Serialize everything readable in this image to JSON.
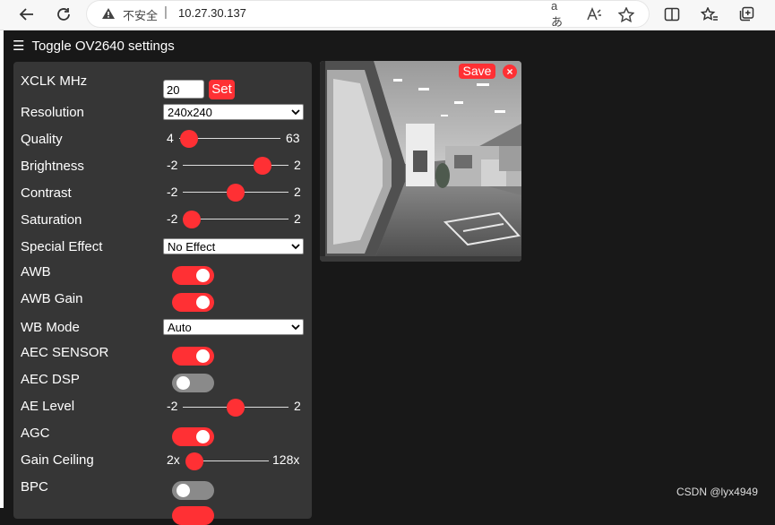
{
  "browser": {
    "security_text": "不安全",
    "separator": "|",
    "url": "10.27.30.137",
    "read_aloud_icon": "aあ"
  },
  "header": {
    "hamburger": "☰",
    "title": "Toggle OV2640 settings"
  },
  "settings": {
    "xclk": {
      "label": "XCLK MHz",
      "value": "20",
      "set_label": "Set"
    },
    "resolution": {
      "label": "Resolution",
      "selected": "240x240"
    },
    "quality": {
      "label": "Quality",
      "min": "4",
      "max": "63",
      "value": 10
    },
    "brightness": {
      "label": "Brightness",
      "min": "-2",
      "max": "2",
      "value": 1
    },
    "contrast": {
      "label": "Contrast",
      "min": "-2",
      "max": "2",
      "value": 0
    },
    "saturation": {
      "label": "Saturation",
      "min": "-2",
      "max": "2",
      "value": -2
    },
    "special_effect": {
      "label": "Special Effect",
      "selected": "No Effect"
    },
    "awb": {
      "label": "AWB",
      "on": true
    },
    "awb_gain": {
      "label": "AWB Gain",
      "on": true
    },
    "wb_mode": {
      "label": "WB Mode",
      "selected": "Auto"
    },
    "aec_sensor": {
      "label": "AEC SENSOR",
      "on": true
    },
    "aec_dsp": {
      "label": "AEC DSP",
      "on": false
    },
    "ae_level": {
      "label": "AE Level",
      "min": "-2",
      "max": "2",
      "value": 0
    },
    "agc": {
      "label": "AGC",
      "on": true
    },
    "gain_ceiling": {
      "label": "Gain Ceiling",
      "min": "2x",
      "max": "128x",
      "value": 0
    },
    "bpc": {
      "label": "BPC",
      "on": false
    }
  },
  "stream": {
    "save_label": "Save",
    "close_label": "×"
  },
  "watermark": "CSDN @lyx4949",
  "colors": {
    "accent": "#ff3034",
    "panel": "#363636",
    "background": "#181818",
    "toggle_off": "#8a8a8a"
  }
}
